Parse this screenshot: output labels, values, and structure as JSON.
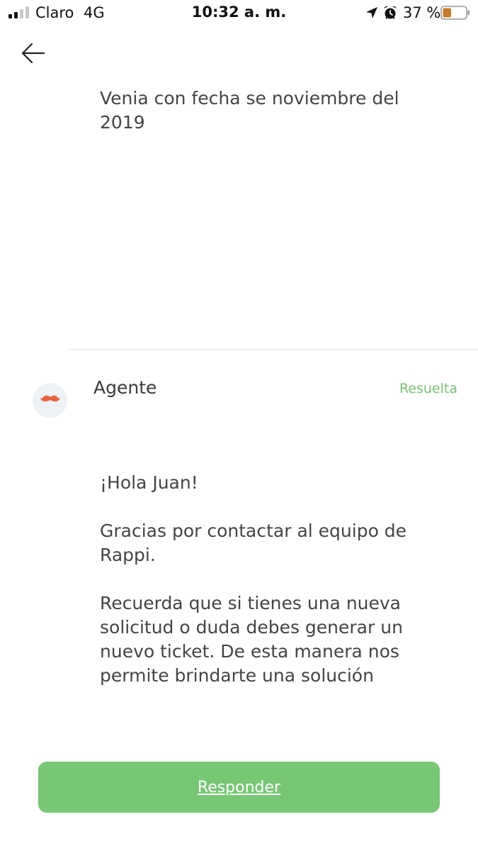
{
  "status_bar": {
    "carrier": "Claro",
    "network": "4G",
    "time": "10:32 a. m.",
    "battery_percent": "37 %",
    "battery_level": 0.37,
    "icons": [
      "signal-icon",
      "location-arrow-icon",
      "alarm-clock-icon",
      "battery-icon"
    ]
  },
  "header": {
    "back_icon": "arrow-left-icon"
  },
  "previous_message": {
    "text": "Venia con fecha se noviembre del 2019"
  },
  "agent_message": {
    "avatar_icon": "mustache-icon",
    "sender": "Agente",
    "status": "Resuelta",
    "paragraphs": [
      "¡Hola Juan!",
      "Gracias por contactar al equipo de Rappi.",
      "Recuerda que si tienes una nueva solicitud o duda debes generar un nuevo ticket. De esta manera nos permite brindarte una solución"
    ]
  },
  "footer": {
    "reply_label": "Responder"
  },
  "colors": {
    "accent_green": "#77c775",
    "status_green": "#77c474",
    "mustache": "#e8623f",
    "avatar_bg": "#eef1f6",
    "battery_fill": "#c87a2c"
  }
}
